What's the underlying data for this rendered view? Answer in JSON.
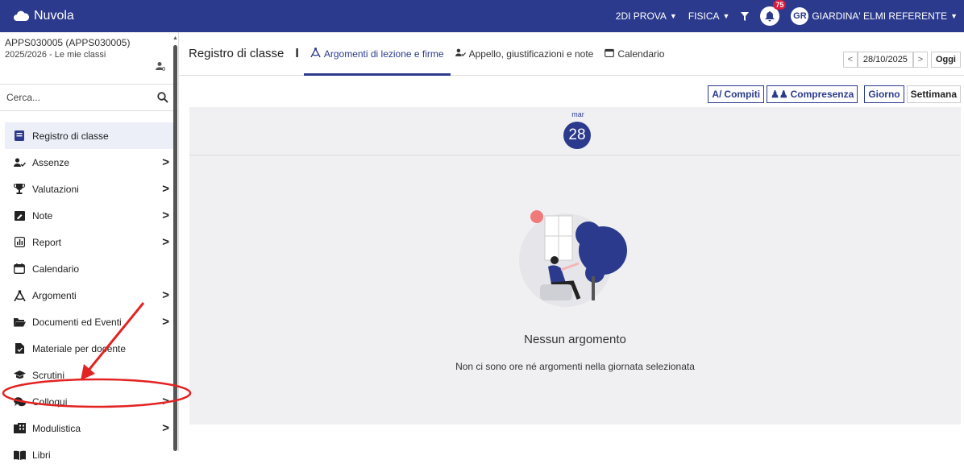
{
  "app": {
    "name": "Nuvola"
  },
  "topbar": {
    "class_selector": "2DI PROVA",
    "subject_selector": "FISICA",
    "notifications_count": "75",
    "avatar_initials": "GR",
    "user_name": "GIARDINA' ELMI REFERENTE"
  },
  "sidebar": {
    "school_code": "APPS030005 (APPS030005)",
    "year_context": "2025/2026 - Le mie classi",
    "search_placeholder": "Cerca...",
    "items": [
      {
        "label": "Registro di classe",
        "icon": "book-icon",
        "active": true,
        "has_submenu": false
      },
      {
        "label": "Assenze",
        "icon": "user-check-icon",
        "has_submenu": true
      },
      {
        "label": "Valutazioni",
        "icon": "trophy-icon",
        "has_submenu": true
      },
      {
        "label": "Note",
        "icon": "note-icon",
        "has_submenu": true
      },
      {
        "label": "Report",
        "icon": "bar-chart-icon",
        "has_submenu": true
      },
      {
        "label": "Calendario",
        "icon": "calendar-icon",
        "has_submenu": false
      },
      {
        "label": "Argomenti",
        "icon": "compass-icon",
        "has_submenu": true
      },
      {
        "label": "Documenti ed Eventi",
        "icon": "folder-icon",
        "has_submenu": true
      },
      {
        "label": "Materiale per docente",
        "icon": "file-icon",
        "has_submenu": false
      },
      {
        "label": "Scrutini",
        "icon": "graduation-cap-icon",
        "has_submenu": false
      },
      {
        "label": "Colloqui",
        "icon": "chat-icon",
        "has_submenu": true
      },
      {
        "label": "Modulistica",
        "icon": "building-icon",
        "has_submenu": true
      },
      {
        "label": "Libri",
        "icon": "books-icon",
        "has_submenu": false
      }
    ]
  },
  "main": {
    "page_title": "Registro di classe",
    "separator": "I",
    "tabs": [
      {
        "label": "Argomenti di lezione e firme",
        "icon": "compass-icon",
        "active": true
      },
      {
        "label": "Appello, giustificazioni e note",
        "icon": "user-check-icon",
        "active": false
      },
      {
        "label": "Calendario",
        "icon": "calendar-icon",
        "active": false
      }
    ],
    "date": "28/10/2025",
    "today_label": "Oggi",
    "toolbar": {
      "compiti": "Compiti",
      "compresenza": "Compresenza",
      "giorno": "Giorno",
      "settimana": "Settimana"
    },
    "day": {
      "weekday": "mar",
      "number": "28"
    },
    "empty": {
      "title": "Nessun argomento",
      "subtitle": "Non ci sono ore né argomenti nella giornata selezionata"
    }
  },
  "colors": {
    "primary": "#2b3a8c",
    "badge": "#d81b3c",
    "annotation": "#e32222"
  }
}
